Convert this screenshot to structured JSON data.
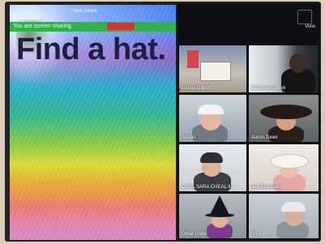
{
  "share": {
    "top_bar_label": "You are screen sharing",
    "toolbar_text": "New Share",
    "headline": "Find a hat."
  },
  "gallery": {
    "view_label": "View",
    "tiles": [
      {
        "name": "Daniel Gilbert"
      },
      {
        "name": "DD Dean Derek"
      },
      {
        "name": "Adrian"
      },
      {
        "name": "Aaron Toner"
      },
      {
        "name": "OOYL SARA CHEAL II..."
      },
      {
        "name": "Ava Ellenburg"
      },
      {
        "name": "Omar Gahn"
      },
      {
        "name": "Nick"
      }
    ]
  }
}
